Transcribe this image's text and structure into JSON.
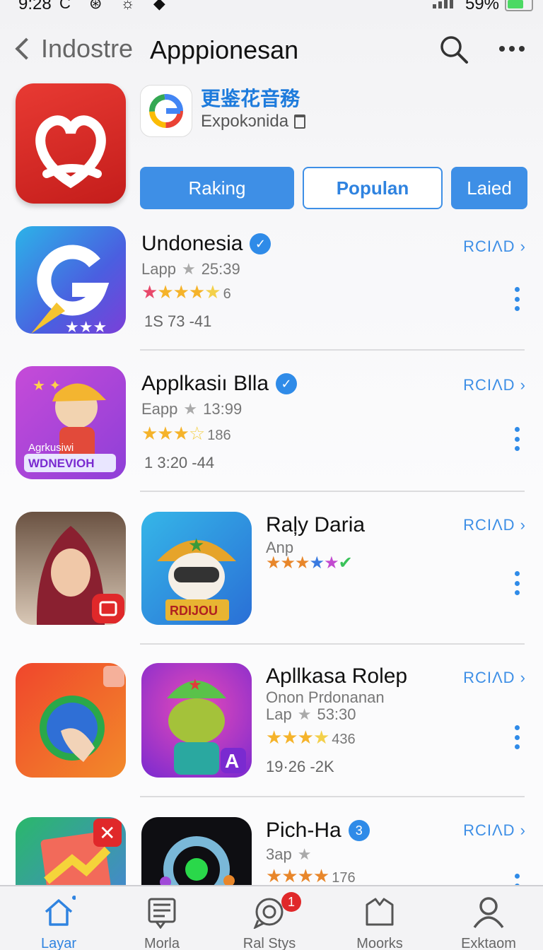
{
  "status_bar": {
    "time": "9:28",
    "icons": "C ⊛ ☼ ◆",
    "battery": "59%"
  },
  "nav": {
    "back_label": "Indostre",
    "title": "Apppionesan"
  },
  "header": {
    "title": "更鉴花音務",
    "subtitle": "Expokɔnida",
    "tabs": [
      "Raking",
      "Populan",
      "Laied"
    ]
  },
  "apps": [
    {
      "name": "Undonesia",
      "verified": true,
      "category": "Lapp",
      "time": "25:39",
      "rating_count": "6",
      "size": "1S 73 -41",
      "action": "RCIΛD"
    },
    {
      "name": "Applkasiı Blla",
      "verified": true,
      "category": "Eapp",
      "time": "13:99",
      "rating_count": "186",
      "size": "1 3:20 -44",
      "action": "RCIΛD"
    },
    {
      "name": "Raļy Daria",
      "verified": false,
      "category": "Anp",
      "time": "",
      "rating_count": "",
      "size": "",
      "action": "RCIΛD"
    },
    {
      "name": "Apllkasa Rolep",
      "verified": false,
      "publisher": "Onon Prdonanan",
      "category": "Lap",
      "time": "53:30",
      "rating_count": "436",
      "size": "19·26 -2K",
      "action": "RCIΛD"
    },
    {
      "name": "Pich-Ha",
      "verified": true,
      "category": "3ap",
      "time": "",
      "rating_count": "176",
      "size": "",
      "action": "RCIΛD"
    }
  ],
  "icon_text": {
    "app2_banner_top": "Agrkusiwi",
    "app2_banner": "WDNEVIOH",
    "app3b_banner": "RDIJOU"
  },
  "tabbar": [
    {
      "label": "Layar",
      "icon": "home-icon",
      "active": true
    },
    {
      "label": "Morla",
      "icon": "news-icon",
      "active": false
    },
    {
      "label": "Ral Stys",
      "icon": "chat-icon",
      "active": false,
      "badge": "1"
    },
    {
      "label": "Moorks",
      "icon": "box-icon",
      "active": false
    },
    {
      "label": "Exktaom",
      "icon": "person-icon",
      "active": false
    }
  ],
  "colors": {
    "accent": "#3e8fe6",
    "star": "#f5b32a",
    "badge": "#e0282a"
  }
}
